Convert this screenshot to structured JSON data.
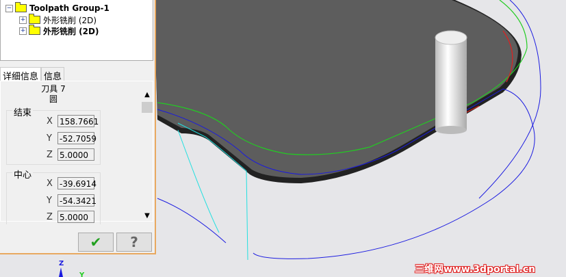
{
  "tree": {
    "root": "Toolpath Group-1",
    "children": [
      "外形铣削 (2D)",
      "外形铣削 (2D)"
    ]
  },
  "tabs": [
    "详细信息",
    "信息"
  ],
  "details": {
    "tool": "刀具 7",
    "type": "圆",
    "end": {
      "label": "结束",
      "x": "158.7661",
      "y": "-52.7059",
      "z": "5.0000"
    },
    "center": {
      "label": "中心",
      "x": "-39.6914",
      "y": "-54.3421",
      "z": "5.0000"
    },
    "axes": [
      "X",
      "Y",
      "Z"
    ]
  },
  "buttons": {
    "ok_icon": "checkmark-icon",
    "help_icon": "question-icon"
  },
  "triad": {
    "z": "Z",
    "y": "Y"
  },
  "watermark": "三维网www.3dportal.cn",
  "colors": {
    "plate": "#5a5a5a",
    "toolpath_green": "#22cc22",
    "toolpath_blue": "#1a1ae0",
    "toolpath_cyan": "#20e0e0",
    "panel_border": "#e8a860"
  }
}
